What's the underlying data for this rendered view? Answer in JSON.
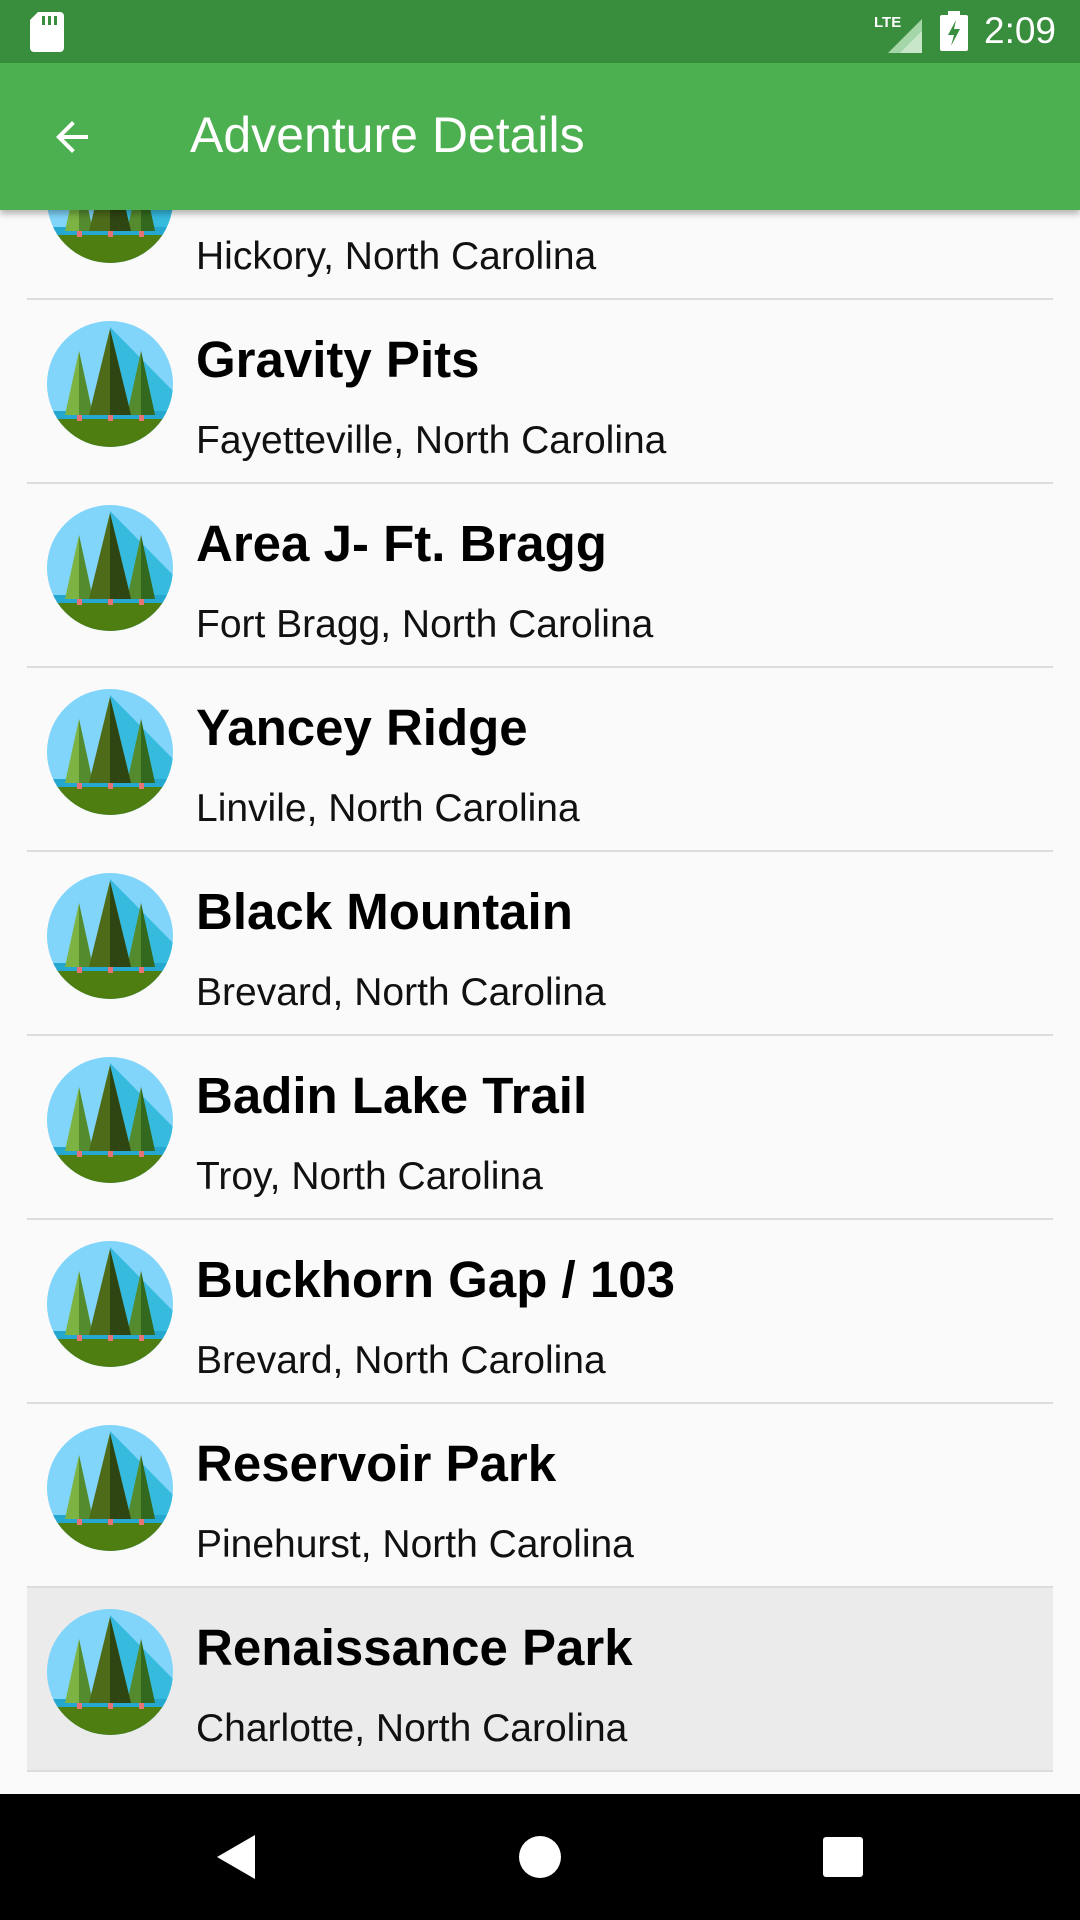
{
  "status_bar": {
    "time": "2:09",
    "network_label": "LTE",
    "icons": [
      "sd-card-icon",
      "lte-signal-icon",
      "battery-charging-icon"
    ]
  },
  "app_bar": {
    "title": "Adventure Details",
    "back_icon": "arrow-back-icon"
  },
  "colors": {
    "status_bar": "#388e3c",
    "app_bar": "#4caf50",
    "list_background": "#fafafa",
    "selected_row": "#ebebeb",
    "divider": "#dcdcdc",
    "nav_bar": "#000000"
  },
  "list": {
    "item_icon": "forest-trees-icon",
    "items": [
      {
        "name": "",
        "location": "Hickory, North Carolina",
        "selected": false
      },
      {
        "name": "Gravity Pits",
        "location": "Fayetteville, North Carolina",
        "selected": false
      },
      {
        "name": "Area J- Ft. Bragg",
        "location": "Fort Bragg, North Carolina",
        "selected": false
      },
      {
        "name": "Yancey Ridge",
        "location": "Linvile, North Carolina",
        "selected": false
      },
      {
        "name": "Black Mountain",
        "location": "Brevard, North Carolina",
        "selected": false
      },
      {
        "name": "Badin Lake Trail",
        "location": "Troy, North Carolina",
        "selected": false
      },
      {
        "name": "Buckhorn Gap / 103",
        "location": "Brevard, North Carolina",
        "selected": false
      },
      {
        "name": "Reservoir Park",
        "location": "Pinehurst, North Carolina",
        "selected": false
      },
      {
        "name": "Renaissance Park",
        "location": "Charlotte, North Carolina",
        "selected": true
      }
    ]
  },
  "nav_bar": {
    "buttons": [
      "back-triangle-icon",
      "home-circle-icon",
      "recents-square-icon"
    ]
  }
}
